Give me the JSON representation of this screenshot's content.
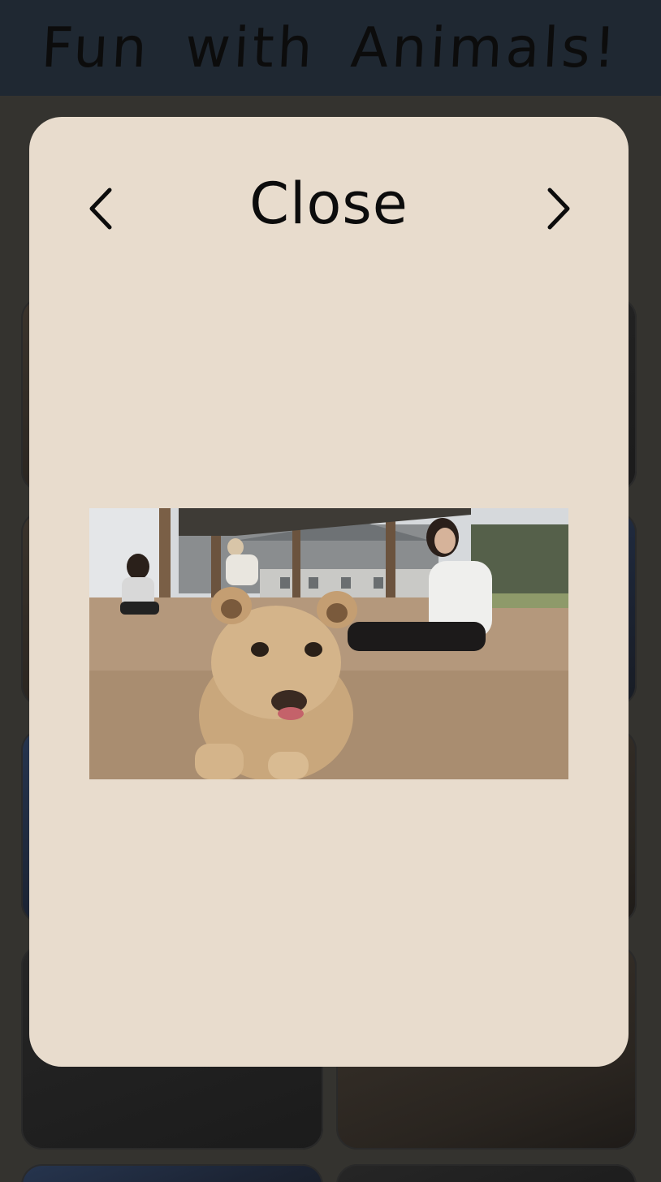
{
  "header": {
    "title": "Fun with Animals!"
  },
  "modal": {
    "close_label": "Close",
    "prev_icon": "chevron-left-icon",
    "next_icon": "chevron-right-icon",
    "image_subject": "lion-cub-photo"
  },
  "colors": {
    "header_bg": "#1f2832",
    "page_bg": "#34332f",
    "modal_bg": "#e8dccd",
    "text": "#0c0c0c"
  }
}
